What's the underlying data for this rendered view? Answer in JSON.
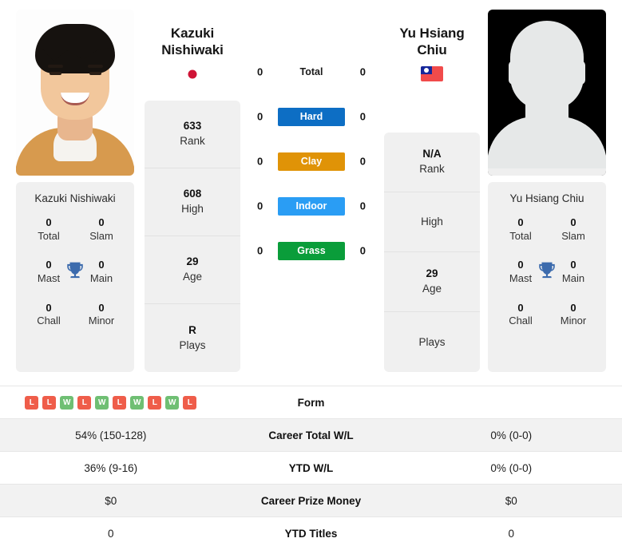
{
  "players": {
    "left": {
      "name_line1": "Kazuki",
      "name_line2": "Nishiwaki",
      "full_name": "Kazuki Nishiwaki",
      "flag": "japan-flag",
      "photo": "player-photo",
      "stats": [
        {
          "value": "633",
          "label": "Rank"
        },
        {
          "value": "608",
          "label": "High"
        },
        {
          "value": "29",
          "label": "Age"
        },
        {
          "value": "R",
          "label": "Plays"
        }
      ],
      "titles": [
        {
          "value": "0",
          "label": "Total"
        },
        {
          "value": "0",
          "label": "Slam"
        },
        {
          "value": "0",
          "label": "Mast"
        },
        {
          "value": "0",
          "label": "Main"
        },
        {
          "value": "0",
          "label": "Chall"
        },
        {
          "value": "0",
          "label": "Minor"
        }
      ]
    },
    "right": {
      "name_line1": "Yu Hsiang",
      "name_line2": "Chiu",
      "full_name": "Yu Hsiang Chiu",
      "flag": "taiwan-flag",
      "photo": "player-photo-placeholder",
      "stats": [
        {
          "value": "N/A",
          "label": "Rank"
        },
        {
          "value": "",
          "label": "High"
        },
        {
          "value": "29",
          "label": "Age"
        },
        {
          "value": "",
          "label": "Plays"
        }
      ],
      "titles": [
        {
          "value": "0",
          "label": "Total"
        },
        {
          "value": "0",
          "label": "Slam"
        },
        {
          "value": "0",
          "label": "Mast"
        },
        {
          "value": "0",
          "label": "Main"
        },
        {
          "value": "0",
          "label": "Chall"
        },
        {
          "value": "0",
          "label": "Minor"
        }
      ]
    }
  },
  "surfaces": [
    {
      "label": "Total",
      "left": "0",
      "right": "0",
      "color": "",
      "plain": true
    },
    {
      "label": "Hard",
      "left": "0",
      "right": "0",
      "color": "#0d6ec4",
      "plain": false
    },
    {
      "label": "Clay",
      "left": "0",
      "right": "0",
      "color": "#e09307",
      "plain": false
    },
    {
      "label": "Indoor",
      "left": "0",
      "right": "0",
      "color": "#2a9df4",
      "plain": false
    },
    {
      "label": "Grass",
      "left": "0",
      "right": "0",
      "color": "#0a9d3a",
      "plain": false
    }
  ],
  "comparison_table": [
    {
      "label": "Form",
      "left_form": [
        "L",
        "L",
        "W",
        "L",
        "W",
        "L",
        "W",
        "L",
        "W",
        "L"
      ],
      "left": "",
      "right": "",
      "alt": false
    },
    {
      "label": "Career Total W/L",
      "left": "54% (150-128)",
      "right": "0% (0-0)",
      "alt": true
    },
    {
      "label": "YTD W/L",
      "left": "36% (9-16)",
      "right": "0% (0-0)",
      "alt": false
    },
    {
      "label": "Career Prize Money",
      "left": "$0",
      "right": "$0",
      "alt": true
    },
    {
      "label": "YTD Titles",
      "left": "0",
      "right": "0",
      "alt": false
    }
  ],
  "colors": {
    "hard": "#0d6ec4",
    "clay": "#e09307",
    "indoor": "#2a9df4",
    "grass": "#0a9d3a",
    "win": "#6fbf73",
    "loss": "#ef5d4a",
    "trophy": "#3c6bad",
    "card_bg": "#f0f0f0",
    "row_alt": "#f2f2f2"
  }
}
